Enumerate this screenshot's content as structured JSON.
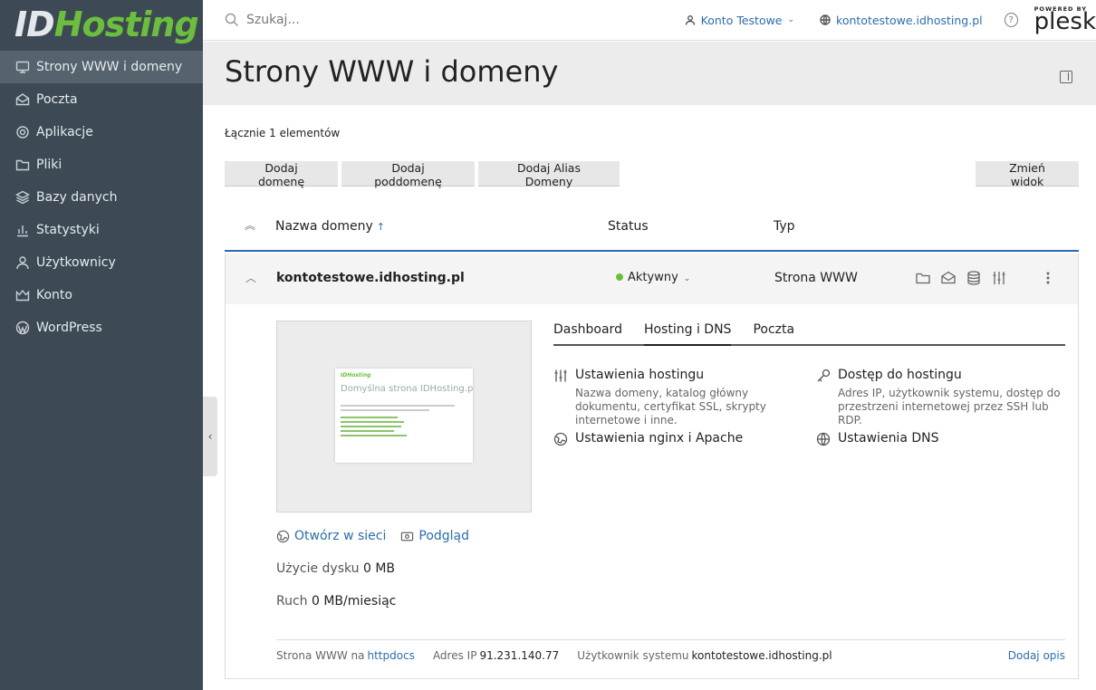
{
  "brand": {
    "logo_part1": "ID",
    "logo_part2": "Hosting",
    "accent": "#6bbf3a"
  },
  "sidebar": {
    "items": [
      {
        "label": "Strony WWW i domeny",
        "icon": "monitor-icon",
        "active": true
      },
      {
        "label": "Poczta",
        "icon": "mail-icon"
      },
      {
        "label": "Aplikacje",
        "icon": "gear-icon"
      },
      {
        "label": "Pliki",
        "icon": "folder-icon"
      },
      {
        "label": "Bazy danych",
        "icon": "database-icon"
      },
      {
        "label": "Statystyki",
        "icon": "bar-chart-icon"
      },
      {
        "label": "Użytkownicy",
        "icon": "user-icon"
      },
      {
        "label": "Konto",
        "icon": "account-icon"
      },
      {
        "label": "WordPress",
        "icon": "wordpress-icon"
      }
    ]
  },
  "header": {
    "search_placeholder": "Szukaj...",
    "user": "Konto Testowe",
    "domain": "kontotestowe.idhosting.pl",
    "powered_by": "POWERED BY",
    "plesk": "plesk"
  },
  "page": {
    "title": "Strony WWW i domeny"
  },
  "list": {
    "total": "Łącznie 1 elementów",
    "buttons": {
      "add_domain": "Dodaj domenę",
      "add_subdomain": "Dodaj poddomenę",
      "add_alias": "Dodaj Alias Domeny",
      "change_view": "Zmień widok"
    },
    "columns": {
      "name": "Nazwa domeny",
      "status": "Status",
      "type": "Typ"
    }
  },
  "domain": {
    "name": "kontotestowe.idhosting.pl",
    "status": "Aktywny",
    "type": "Strona WWW",
    "preview": {
      "logo": "IDHosting",
      "title": "Domyślna strona IDHosting.pl"
    },
    "open_web": "Otwórz w sieci",
    "preview_link": "Podgląd",
    "disk_label": "Użycie dysku",
    "disk_value": "0 MB",
    "traffic_label": "Ruch",
    "traffic_value": "0 MB/miesiąc",
    "tabs": [
      "Dashboard",
      "Hosting i DNS",
      "Poczta"
    ],
    "tools": {
      "hosting_settings": {
        "title": "Ustawienia hostingu",
        "desc": "Nazwa domeny, katalog główny dokumentu, certyfikat SSL, skrypty internetowe i inne."
      },
      "hosting_access": {
        "title": "Dostęp do hostingu",
        "desc": "Adres IP, użytkownik systemu, dostęp do przestrzeni internetowej przez SSH lub RDP."
      },
      "nginx": {
        "title": "Ustawienia nginx i Apache"
      },
      "dns": {
        "title": "Ustawienia DNS"
      }
    },
    "footer": {
      "site_label": "Strona WWW na",
      "site_value": "httpdocs",
      "ip_label": "Adres IP",
      "ip_value": "91.231.140.77",
      "user_label": "Użytkownik systemu",
      "user_value": "kontotestowe.idhosting.pl",
      "add_desc": "Dodaj opis"
    }
  }
}
